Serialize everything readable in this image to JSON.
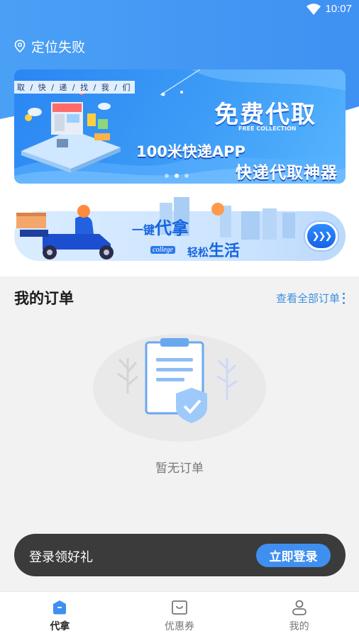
{
  "status_bar": {
    "time": "10:07"
  },
  "location": {
    "text": "定位失败"
  },
  "banner1": {
    "top_tag": "取 / 快 / 递 / 找 / 我 / 们",
    "title": "免费代取",
    "subtitle": "FREE COLLECTION",
    "line1": "100米快递APP",
    "line2": "快递代取神器",
    "dots_total": 3,
    "active_dot": 1
  },
  "banner2": {
    "line1_small": "一键",
    "line1_big": "代拿",
    "college": "college",
    "line2_small": "轻松",
    "line2_big": "生活"
  },
  "orders": {
    "title": "我的订单",
    "view_all": "查看全部订单",
    "empty_text": "暂无订单"
  },
  "login_bar": {
    "text": "登录领好礼",
    "button": "立即登录"
  },
  "tabbar": {
    "items": [
      {
        "label": "代拿",
        "icon": "delivery-icon",
        "active": true
      },
      {
        "label": "优惠券",
        "icon": "coupon-bag-icon",
        "active": false
      },
      {
        "label": "我的",
        "icon": "profile-icon",
        "active": false
      }
    ]
  },
  "colors": {
    "primary": "#3f8ff1",
    "banner_blue": "#2a86f3",
    "login_bar_bg": "#3b3b3b",
    "link_blue": "#3a8fe0"
  }
}
